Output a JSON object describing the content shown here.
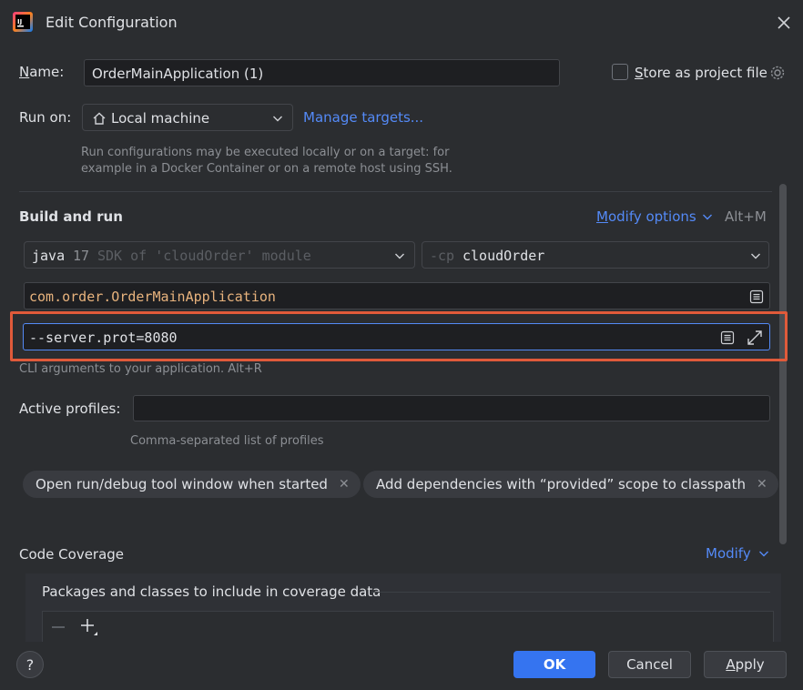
{
  "window": {
    "title": "Edit Configuration"
  },
  "name": {
    "label_prefix": "N",
    "label_rest": "ame:",
    "value": "OrderMainApplication (1)",
    "store_prefix": "S",
    "store_rest": "tore as project file",
    "store_checked": false
  },
  "run_on": {
    "label": "Run on:",
    "value": "Local machine",
    "manage_link": "Manage targets...",
    "help_line1": "Run configurations may be executed locally or on a target: for",
    "help_line2": "example in a Docker Container or on a remote host using SSH."
  },
  "build": {
    "title": "Build and run",
    "modify_prefix": "M",
    "modify_rest": "odify options",
    "modify_shortcut": "Alt+M",
    "jdk_java": "java",
    "jdk_version": "17",
    "jdk_hint": "SDK of 'cloudOrder' module",
    "cp_flag": "-cp",
    "cp_value": "cloudOrder",
    "main_class": "com.order.OrderMainApplication",
    "args_value": "--server.prot=8080",
    "args_hint": "CLI arguments to your application. Alt+R"
  },
  "profiles": {
    "label": "Active profiles:",
    "value": "",
    "hint": "Comma-separated list of profiles"
  },
  "chips": [
    {
      "label": "Open run/debug tool window when started"
    },
    {
      "label": "Add dependencies with “provided” scope to classpath"
    }
  ],
  "coverage": {
    "title": "Code Coverage",
    "modify": "Modify",
    "packages_label": "Packages and classes to include in coverage data"
  },
  "footer": {
    "help": "?",
    "ok": "OK",
    "cancel": "Cancel",
    "apply_prefix": "A",
    "apply_rest": "pply"
  },
  "colors": {
    "background": "#2b2d30",
    "accent": "#548af7",
    "ok_button": "#3574f0",
    "highlight_box": "#e05a3a"
  }
}
